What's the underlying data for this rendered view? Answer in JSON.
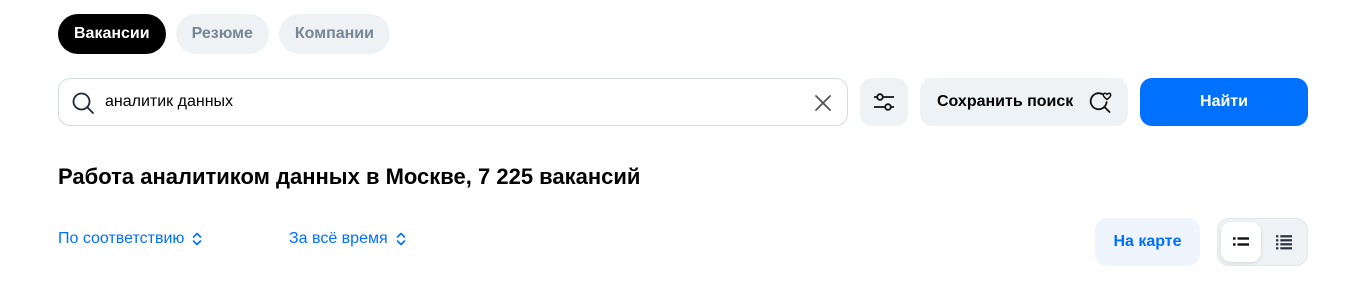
{
  "tabs": [
    {
      "label": "Вакансии",
      "active": true
    },
    {
      "label": "Резюме",
      "active": false
    },
    {
      "label": "Компании",
      "active": false
    }
  ],
  "search": {
    "value": "аналитик данных",
    "icon": "search-icon",
    "clear_icon": "close-icon"
  },
  "toolbar": {
    "filter_icon": "sliders-icon",
    "save_label": "Сохранить поиск",
    "save_icon": "search-heart-icon",
    "find_label": "Найти"
  },
  "results": {
    "heading": "Работа аналитиком данных в Москве, 7 225 вакансий"
  },
  "sorting": {
    "order_label": "По соответствию",
    "period_label": "За всё время"
  },
  "view": {
    "map_label": "На карте",
    "options": [
      "compact-list-icon",
      "detailed-list-icon"
    ],
    "selected": "compact-list-icon"
  },
  "colors": {
    "accent": "#0070ff",
    "active_tab_bg": "#000000",
    "chip_bg": "#eff2f5",
    "muted_text": "#768694"
  }
}
